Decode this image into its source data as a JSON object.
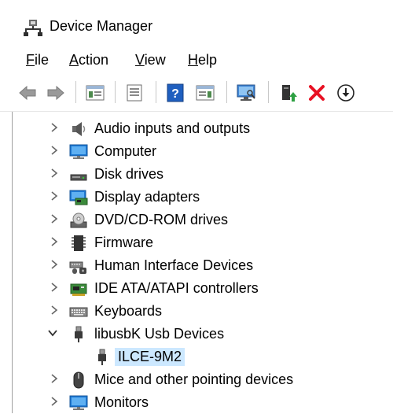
{
  "window": {
    "title": "Device Manager",
    "icon": "device-manager-icon"
  },
  "menu": {
    "items": [
      {
        "mnemonic": "F",
        "rest": "ile"
      },
      {
        "mnemonic": "A",
        "rest": "ction"
      },
      {
        "mnemonic": "V",
        "rest": "iew"
      },
      {
        "mnemonic": "H",
        "rest": "elp"
      }
    ]
  },
  "toolbar": {
    "buttons": [
      "back-icon",
      "forward-icon",
      "show-hide-console-tree-icon",
      "properties-icon",
      "help-icon",
      "action-pane-icon",
      "scan-for-hardware-changes-icon",
      "update-driver-icon",
      "uninstall-device-icon",
      "download-icon"
    ]
  },
  "tree": {
    "items": [
      {
        "label": "Audio inputs and outputs",
        "expanded": false,
        "icon": "speaker-icon"
      },
      {
        "label": "Computer",
        "expanded": false,
        "icon": "monitor-icon"
      },
      {
        "label": "Disk drives",
        "expanded": false,
        "icon": "disk-drive-icon"
      },
      {
        "label": "Display adapters",
        "expanded": false,
        "icon": "display-adapter-icon"
      },
      {
        "label": "DVD/CD-ROM drives",
        "expanded": false,
        "icon": "dvd-drive-icon"
      },
      {
        "label": "Firmware",
        "expanded": false,
        "icon": "chip-icon"
      },
      {
        "label": "Human Interface Devices",
        "expanded": false,
        "icon": "hid-icon"
      },
      {
        "label": "IDE ATA/ATAPI controllers",
        "expanded": false,
        "icon": "ide-controller-icon"
      },
      {
        "label": "Keyboards",
        "expanded": false,
        "icon": "keyboard-icon"
      },
      {
        "label": "libusbK Usb Devices",
        "expanded": true,
        "icon": "usb-plug-icon"
      },
      {
        "label": "ILCE-9M2",
        "child": true,
        "selected": true,
        "icon": "usb-plug-icon"
      },
      {
        "label": "Mice and other pointing devices",
        "expanded": false,
        "icon": "mouse-icon"
      },
      {
        "label": "Monitors",
        "expanded": false,
        "icon": "monitor-icon"
      }
    ]
  },
  "colors": {
    "selection": "#cce8ff",
    "uninstall_red": "#e81123",
    "update_green": "#2ea043"
  }
}
